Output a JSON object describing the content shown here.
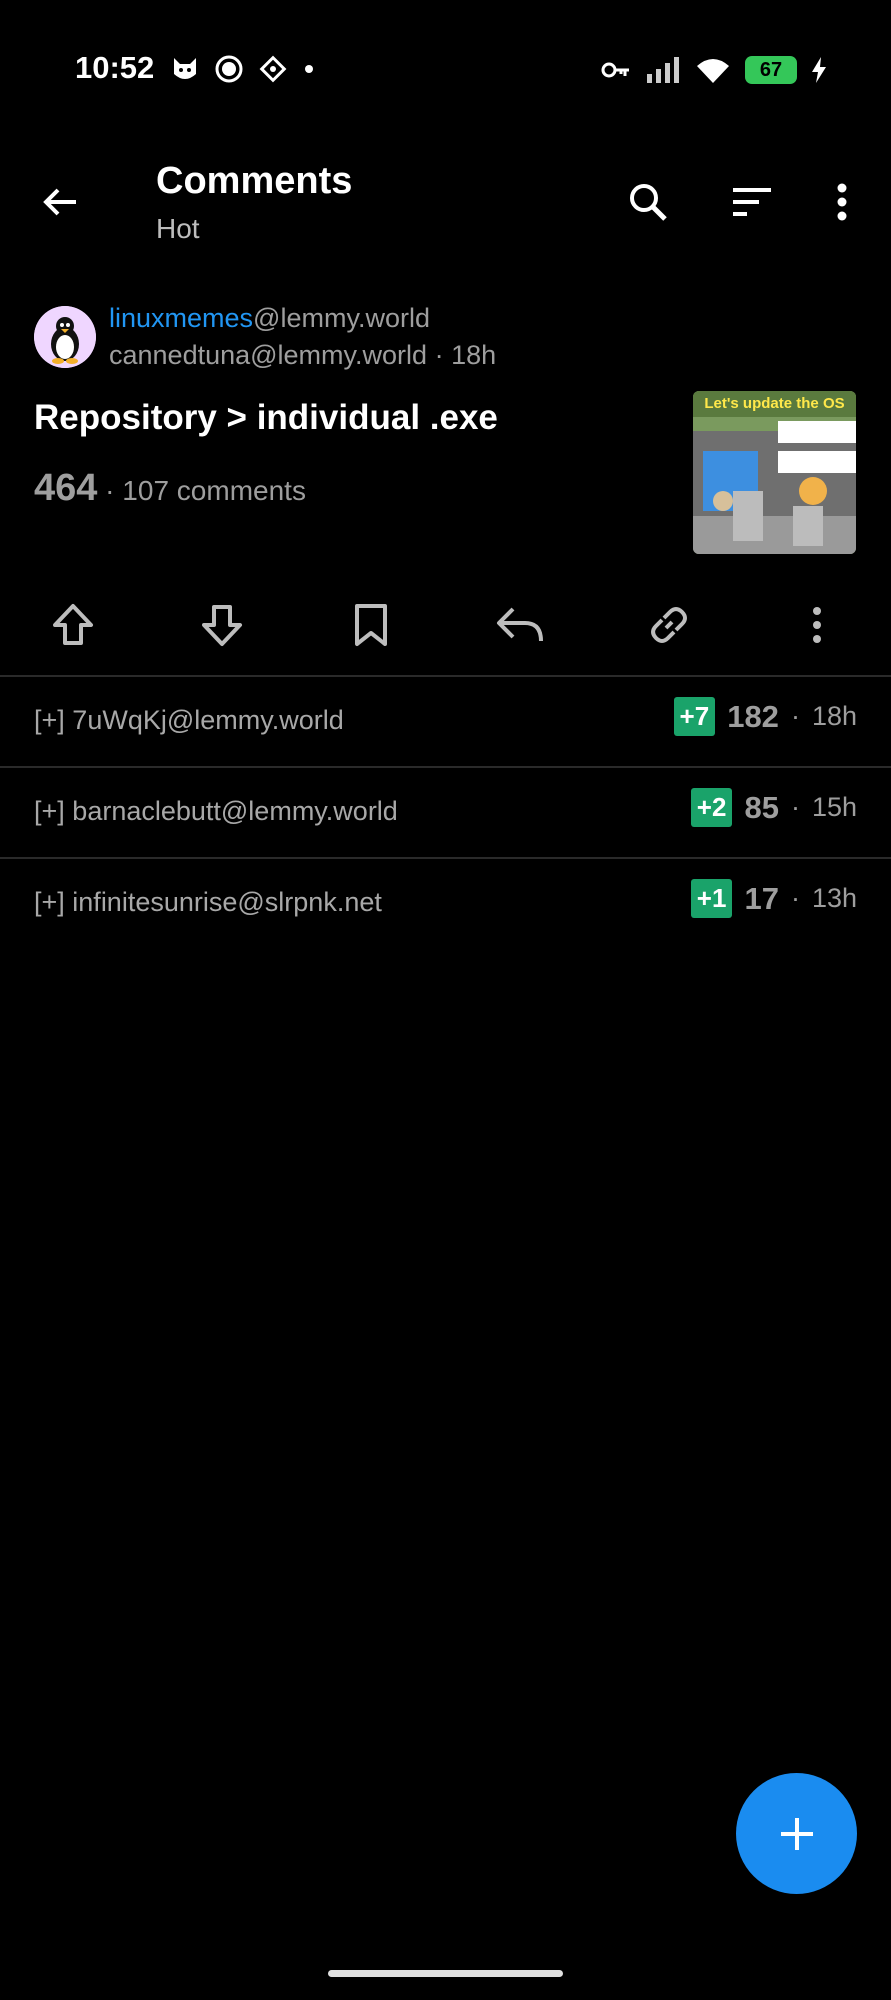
{
  "status_bar": {
    "time": "10:52",
    "battery": "67"
  },
  "toolbar": {
    "title": "Comments",
    "subtitle": "Hot"
  },
  "post": {
    "community_name": "linuxmemes",
    "community_instance": "@lemmy.world",
    "author": "cannedtuna@lemmy.world",
    "time": "18h",
    "title": "Repository > individual .exe",
    "score": "464",
    "comments": "107 comments",
    "thumbnail_caption": "Let's update the OS"
  },
  "comments": [
    {
      "prefix": "[+]",
      "user": "7uWqKj@lemmy.world",
      "badge": "+7",
      "score": "182",
      "time": "18h"
    },
    {
      "prefix": "[+]",
      "user": "barnaclebutt@lemmy.world",
      "badge": "+2",
      "score": "85",
      "time": "15h"
    },
    {
      "prefix": "[+]",
      "user": "infinitesunrise@slrpnk.net",
      "badge": "+1",
      "score": "17",
      "time": "13h"
    }
  ],
  "colors": {
    "accent": "#2196f3",
    "badge": "#1aa36a",
    "fab": "#1a8cf0"
  }
}
